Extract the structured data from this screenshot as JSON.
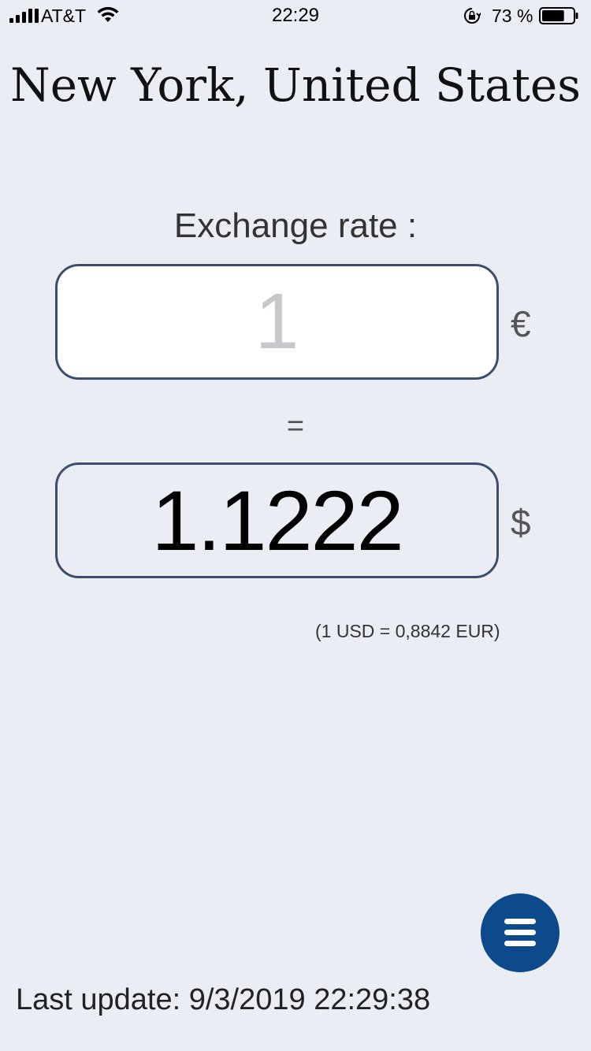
{
  "status_bar": {
    "carrier": "AT&T",
    "time": "22:29",
    "battery_percent": "73 %",
    "battery_level": 0.73
  },
  "header": {
    "city_title": "New York, United States"
  },
  "converter": {
    "label": "Exchange rate :",
    "input_value": "1",
    "input_currency_symbol": "€",
    "equals": "=",
    "result_value": "1.1222",
    "result_currency_symbol": "$",
    "rate_note": "(1 USD = 0,8842 EUR)"
  },
  "footer": {
    "last_update": "Last update: 9/3/2019 22:29:38"
  },
  "colors": {
    "background": "#EAEDF4",
    "box_border": "#3D4E6B",
    "menu_button": "#0D4A8C"
  }
}
